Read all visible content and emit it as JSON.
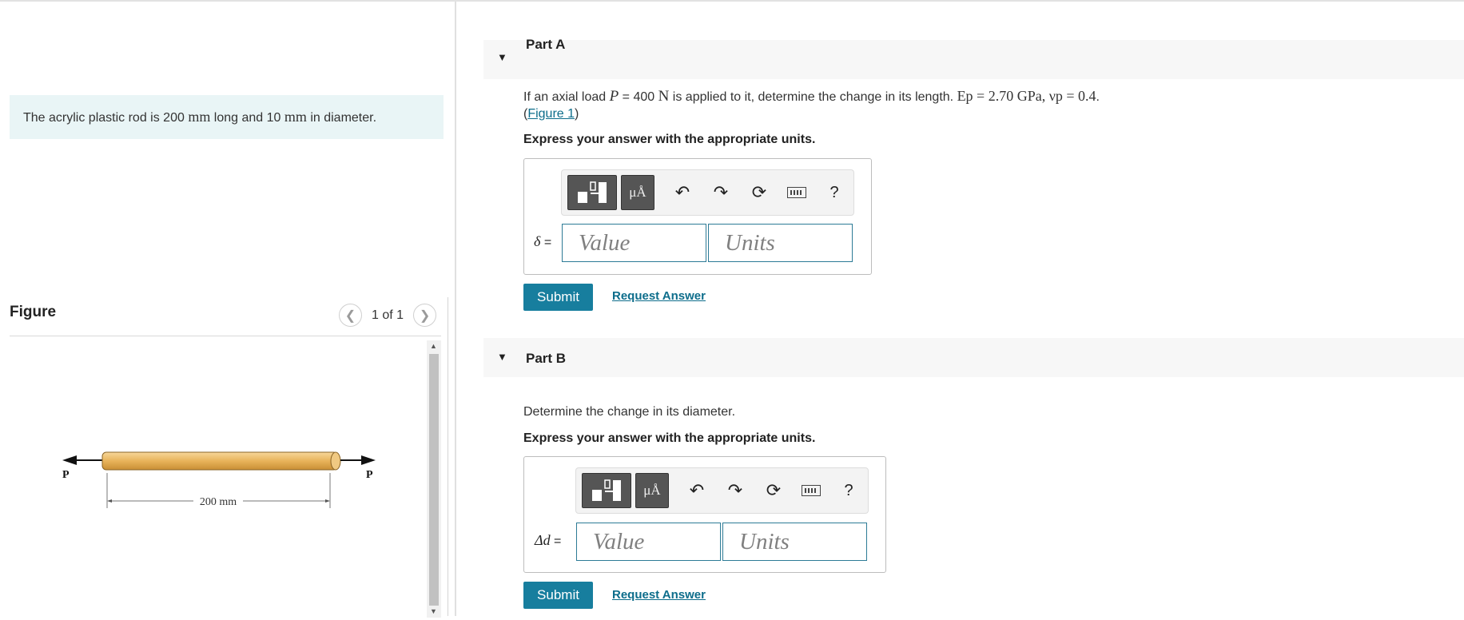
{
  "intro": {
    "text_before": "The acrylic plastic rod is 200 ",
    "unit1": "mm",
    "text_mid": " long and 10 ",
    "unit2": "mm",
    "text_after": " in diameter."
  },
  "figure": {
    "title": "Figure",
    "page_indicator": "1 of 1",
    "prev_icon": "chevron-left-icon",
    "next_icon": "chevron-right-icon",
    "load_label_left": "P",
    "load_label_right": "P",
    "dimension_label": "200 mm",
    "rod_color": "#e8b35a"
  },
  "partA": {
    "title": "Part A",
    "question_prefix": "If an axial load ",
    "load_symbol": "P",
    "load_value": " = 400 ",
    "load_unit": "N",
    "question_mid": " is applied to it, determine the change in its length. ",
    "material_props": "Ep = 2.70 GPa, νp = 0.4",
    "question_end": ".",
    "figure_link_open": "(",
    "figure_link": "Figure 1",
    "figure_link_close": ")",
    "express": "Express your answer with the appropriate units.",
    "variable": "δ",
    "equals": " =",
    "value_placeholder": "Value",
    "units_placeholder": "Units",
    "submit": "Submit",
    "request": "Request Answer"
  },
  "partB": {
    "title": "Part B",
    "question": "Determine the change in its diameter.",
    "express": "Express your answer with the appropriate units.",
    "variable": "Δd",
    "equals": " =",
    "value_placeholder": "Value",
    "units_placeholder": "Units",
    "submit": "Submit",
    "request": "Request Answer"
  },
  "toolbar": {
    "template_icon": "fraction-template-icon",
    "units_button": "μÅ",
    "undo_icon": "undo-icon",
    "redo_icon": "redo-icon",
    "reset_icon": "reset-icon",
    "keyboard_icon": "keyboard-icon",
    "help": "?"
  },
  "colors": {
    "accent": "#177e9e",
    "link": "#0d6d8b",
    "intro_bg": "#e9f5f6",
    "part_header_bg": "#f7f7f7"
  }
}
